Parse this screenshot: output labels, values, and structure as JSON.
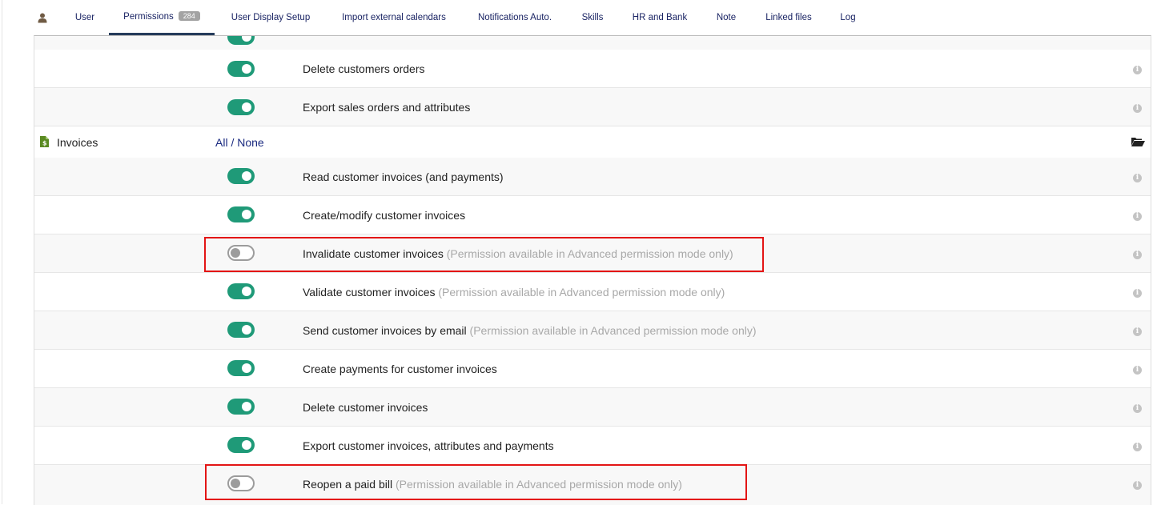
{
  "tabs": [
    {
      "label": "User"
    },
    {
      "label": "Permissions",
      "badge": "284"
    },
    {
      "label": "User Display Setup"
    },
    {
      "label": "Import external calendars"
    },
    {
      "label": "Notifications Auto."
    },
    {
      "label": "Skills"
    },
    {
      "label": "HR and Bank"
    },
    {
      "label": "Note"
    },
    {
      "label": "Linked files"
    },
    {
      "label": "Log"
    }
  ],
  "active_tab": "Permissions",
  "colors": {
    "toggle_on": "#1f9a78",
    "toggle_off": "#9c9c9c",
    "highlight": "#e31515",
    "link": "#1a2a80"
  },
  "orders": {
    "permissions": [
      {
        "label": "Delete customers orders",
        "enabled": true
      },
      {
        "label": "Export sales orders and attributes",
        "enabled": true
      }
    ]
  },
  "invoices": {
    "group_label": "Invoices",
    "all_label": "All",
    "separator": "/",
    "none_label": "None",
    "permissions": [
      {
        "label": "Read customer invoices (and payments)",
        "enabled": true,
        "note": ""
      },
      {
        "label": "Create/modify customer invoices",
        "enabled": true,
        "note": ""
      },
      {
        "label": "Invalidate customer invoices",
        "enabled": false,
        "note": "(Permission available in Advanced permission mode only)"
      },
      {
        "label": "Validate customer invoices",
        "enabled": true,
        "note": "(Permission available in Advanced permission mode only)"
      },
      {
        "label": "Send customer invoices by email",
        "enabled": true,
        "note": "(Permission available in Advanced permission mode only)"
      },
      {
        "label": "Create payments for customer invoices",
        "enabled": true,
        "note": ""
      },
      {
        "label": "Delete customer invoices",
        "enabled": true,
        "note": ""
      },
      {
        "label": "Export customer invoices, attributes and payments",
        "enabled": true,
        "note": ""
      },
      {
        "label": "Reopen a paid bill",
        "enabled": false,
        "note": "(Permission available in Advanced permission mode only)"
      }
    ]
  }
}
